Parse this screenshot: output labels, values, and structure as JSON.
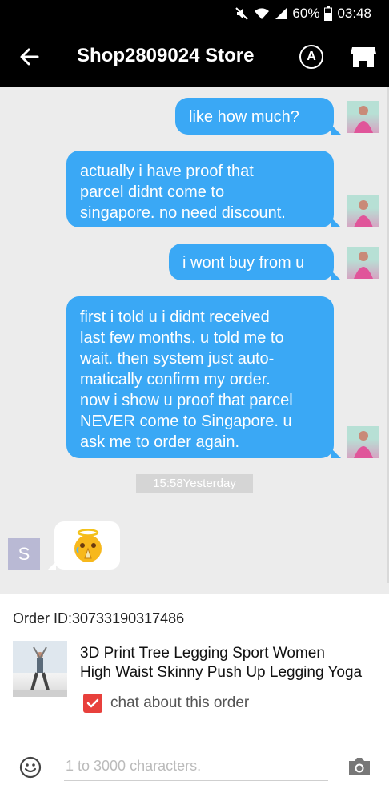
{
  "status_bar": {
    "battery": "60%",
    "time": "03:48"
  },
  "header": {
    "title": "Shop2809024 Store",
    "translate_label": "A"
  },
  "messages": [
    {
      "from": "me",
      "text": "like how much?"
    },
    {
      "from": "me",
      "lines": [
        "actually i have proof that",
        "parcel didnt come to",
        "singapore.  no need discount."
      ]
    },
    {
      "from": "me",
      "text": "i wont buy from u"
    },
    {
      "from": "me",
      "lines": [
        "first i told u i didnt received",
        "last few months. u told me to",
        "wait.  then system just auto-",
        "matically confirm my order.",
        "now i show u proof that parcel",
        "NEVER come to Singapore. u",
        "ask me to order again."
      ]
    }
  ],
  "timestamp": "15:58Yesterday",
  "seller": {
    "avatar_letter": "S",
    "sticker_icon": "praying-emoji-icon"
  },
  "order": {
    "label": "Order ID:",
    "id": "30733190317486",
    "product_title_lines": [
      "3D Print Tree Legging Sport Women",
      "High Waist Skinny Push Up Legging Yoga"
    ],
    "chat_option_label": "chat about this order",
    "chat_option_checked": true
  },
  "composer": {
    "placeholder": "1 to 3000 characters."
  },
  "colors": {
    "bubble_me": "#3aa8f5",
    "header_bg": "#000000",
    "checkbox": "#e8403c"
  }
}
